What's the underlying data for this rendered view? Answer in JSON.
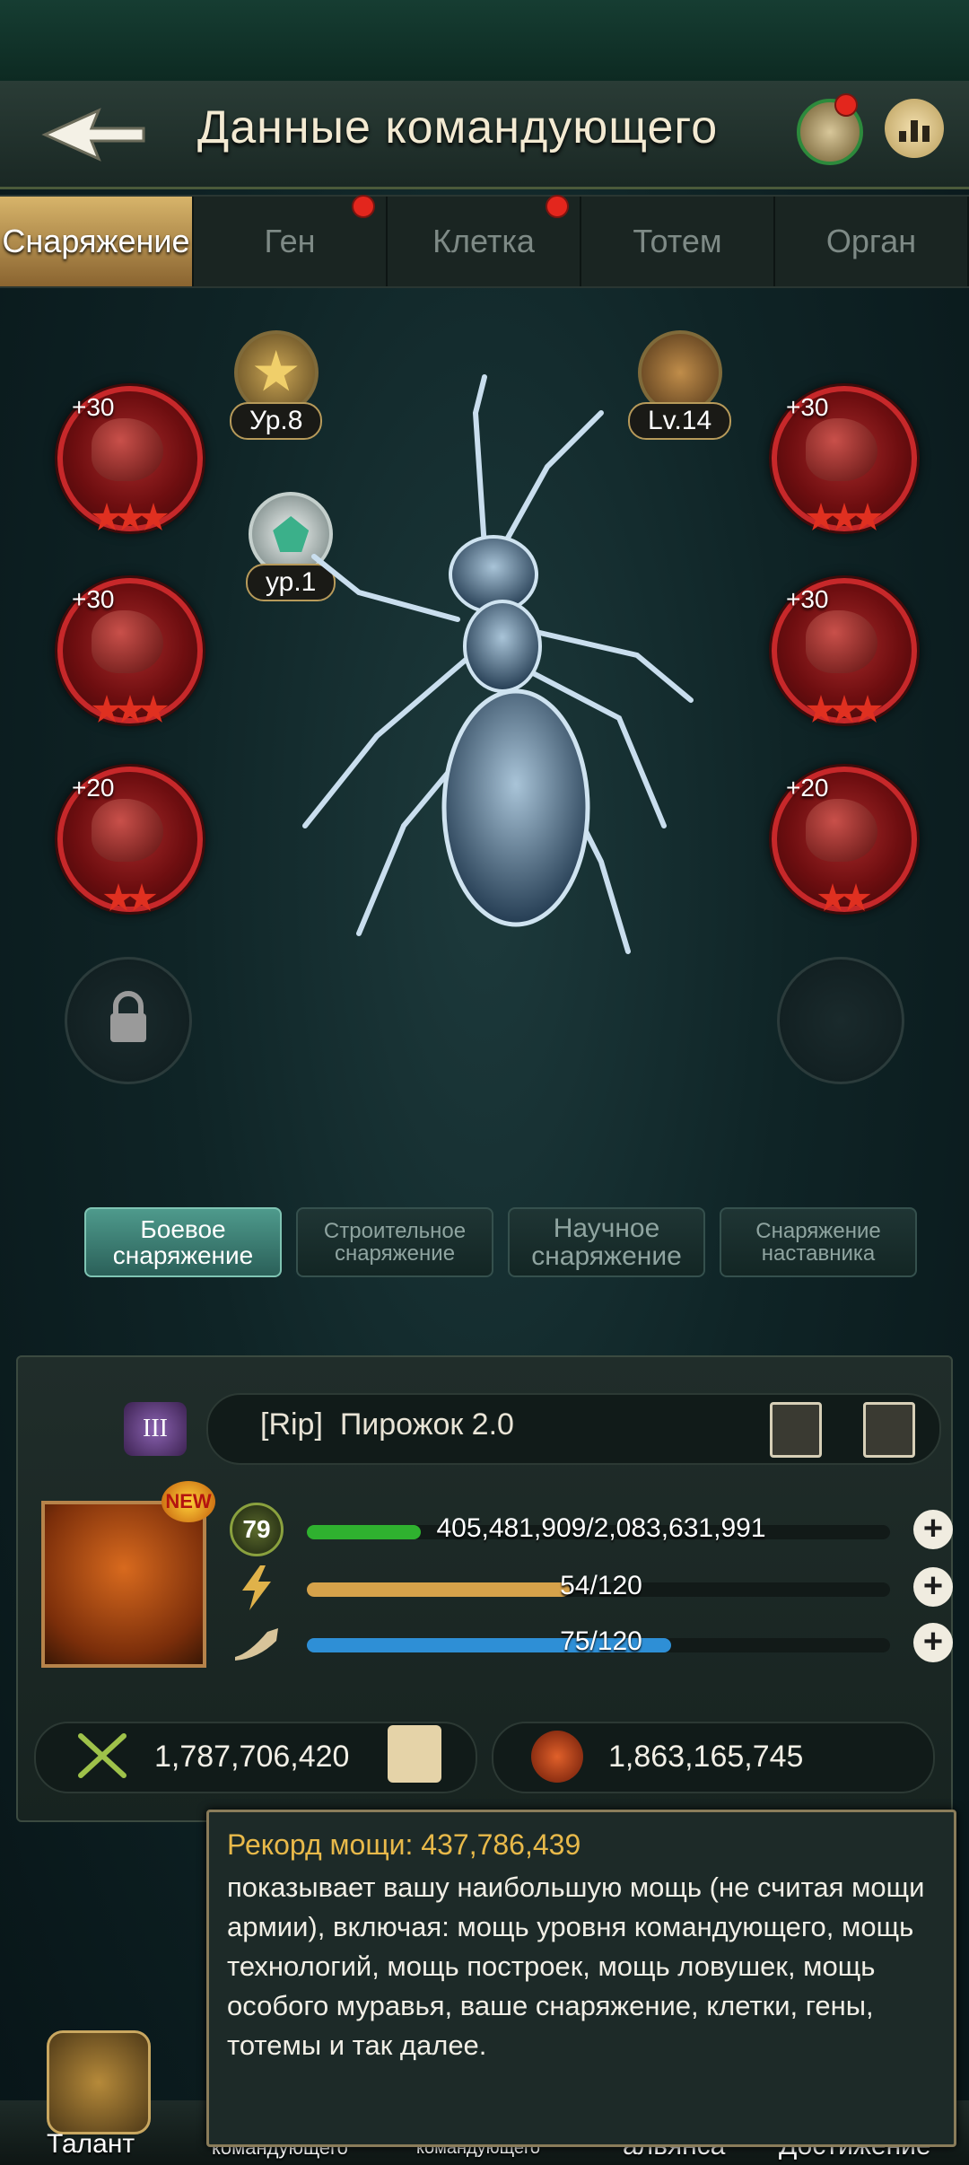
{
  "header": {
    "title": "Данные командующего"
  },
  "tabs": [
    {
      "label": "Снаряжение",
      "active": true,
      "dot": false
    },
    {
      "label": "Ген",
      "active": false,
      "dot": true
    },
    {
      "label": "Клетка",
      "active": false,
      "dot": true
    },
    {
      "label": "Тотем",
      "active": false,
      "dot": false
    },
    {
      "label": "Орган",
      "active": false,
      "dot": false
    }
  ],
  "medals": {
    "star_level": "Ур.8",
    "larva_level": "Lv.14",
    "crest_level": "ур.1"
  },
  "gear_slots": {
    "left": [
      {
        "bonus": "+30",
        "stars": 3
      },
      {
        "bonus": "+30",
        "stars": 3
      },
      {
        "bonus": "+20",
        "stars": 2
      }
    ],
    "right": [
      {
        "bonus": "+30",
        "stars": 3
      },
      {
        "bonus": "+30",
        "stars": 3
      },
      {
        "bonus": "+20",
        "stars": 2
      }
    ]
  },
  "categories": [
    {
      "label": "Боевое снаряжение",
      "active": true
    },
    {
      "label": "Строительное снаряжение",
      "active": false
    },
    {
      "label": "Научное снаряжение",
      "active": false
    },
    {
      "label": "Снаряжение наставника",
      "active": false
    }
  ],
  "commander": {
    "tag": "[Rip]",
    "name": "Пирожок 2.0",
    "rank_numeral": "III",
    "new_badge": "NEW",
    "level": "79",
    "exp": "405,481,909/2,083,631,991",
    "exp_fraction": 0.195,
    "energy": "54/120",
    "energy_fraction": 0.45,
    "horn": "75/120",
    "horn_fraction": 0.625,
    "power": "1,787,706,420",
    "army_power": "1,863,165,745"
  },
  "tooltip": {
    "title": "Рекорд мощи: 437,786,439",
    "body": "показывает вашу наибольшую мощь (не считая мощи армии), включая: мощь уровня командующего, мощь технологий, мощь построек, мощь ловушек, мощь особого муравья, ваше снаряжение, клетки, гены, тотемы и так далее."
  },
  "bottom_nav": {
    "talent": "Талант",
    "item2": "командующего",
    "item3": "командующего",
    "item4": "альянса",
    "item5": "Достижение"
  },
  "colors": {
    "exp_bar": "#2fb12f",
    "energy_bar": "#d6a24a",
    "horn_bar": "#2e8fd6",
    "accent_gold": "#e8b94a",
    "gear_red": "#c7282a"
  }
}
